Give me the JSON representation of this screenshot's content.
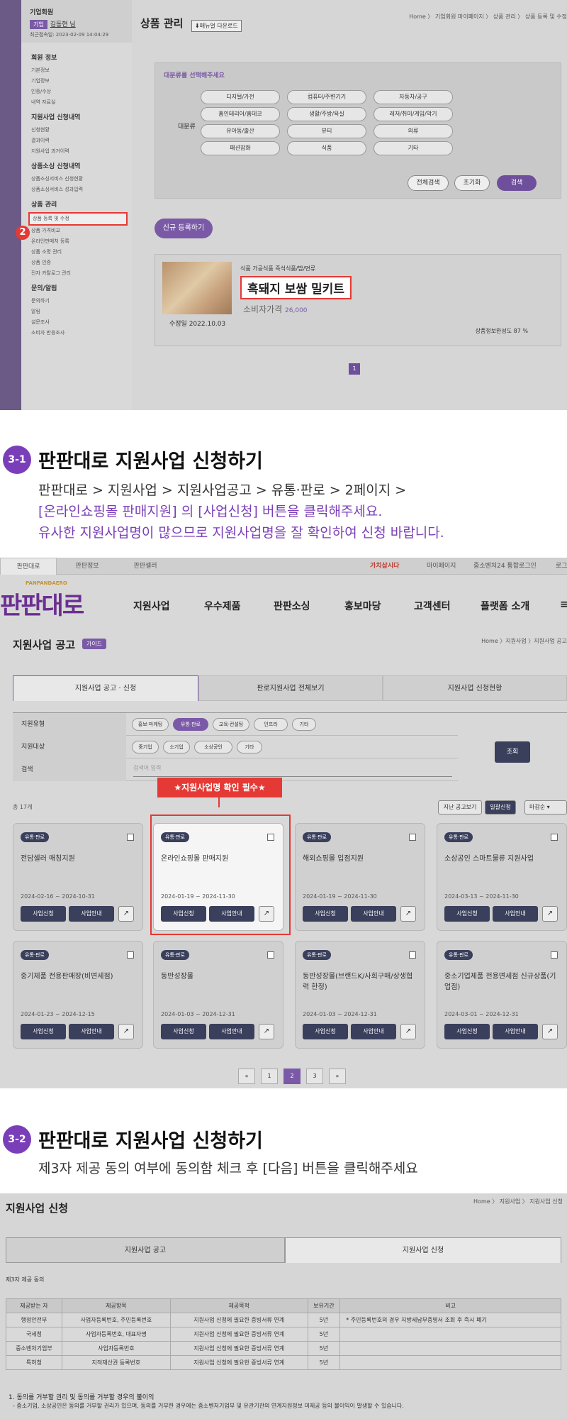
{
  "s1": {
    "user_type": "기업회원",
    "user_badge": "기업",
    "user_name": "김동현 님",
    "last_login": "최근접속일: 2023-02-09 14:04:29",
    "groups": [
      {
        "title": "회원 정보",
        "items": [
          "기본정보",
          "기업정보",
          "인증/수상",
          "내역 자료실"
        ]
      },
      {
        "title": "지원사업 신청내역",
        "items": [
          "신청현황",
          "결과이력",
          "지원사업 과거이력"
        ]
      },
      {
        "title": "상품소싱 신청내역",
        "items": [
          "상품소싱서비스 신청현황",
          "상품소싱서비스 성과입력"
        ]
      },
      {
        "title": "상품 관리",
        "items": [
          "상품 등록 및 수정",
          "상품 가격비교",
          "온라인판매처 등록",
          "상품 소명 관리",
          "상품 인증",
          "전자 카탈로그 관리"
        ]
      },
      {
        "title": "문의/알림",
        "items": [
          "문의하기",
          "알림",
          "설문조사",
          "소비자 반응조사"
        ]
      }
    ],
    "step_marker": "2",
    "page_title": "상품 관리",
    "manual_btn": "⬇매뉴얼 다운로드",
    "breadcrumb": "Home 〉 기업회원 마이페이지 〉 상품 관리 〉 상품 등록 및 수정",
    "filter_title": "대분류를 선택해주세요",
    "filter_label": "대분류",
    "categories": [
      "디지털/가전",
      "컴퓨터/주변기기",
      "자동차/공구",
      "홈인테리어/홈데코",
      "생활/주방/욕실",
      "레저/취미/게임/악기",
      "유아동/출산",
      "뷰티",
      "의류",
      "패션잡화",
      "식품",
      "기타"
    ],
    "btn_all": "전체검색",
    "btn_reset": "초기화",
    "btn_search": "검색",
    "btn_new": "신규 등록하기",
    "product": {
      "cats": "식품    가공식품    즉석식품/밥/면류",
      "name": "흑돼지 보쌈 밀키트",
      "price_label": "소비자가격",
      "price": "26,000",
      "edit_date": "수정일 2022.10.03",
      "completeness": "상품정보완성도 87 %"
    },
    "page": "1"
  },
  "step1": {
    "num": "3-1",
    "title": "판판대로 지원사업 신청하기",
    "line1": "판판대로 > 지원사업 > 지원사업공고 > 유통·판로 > 2페이지 >",
    "line2": "[온라인쇼핑몰 판매지원] 의 [사업신청] 버튼을 클릭해주세요.",
    "line3": "유사한 지원사업명이 많으므로 지원사업명을 잘 확인하여 신청 바랍니다."
  },
  "s2": {
    "top_tabs": [
      "판판대로",
      "판판정보",
      "판판셀러"
    ],
    "top_right": [
      "가치삽시다",
      "마이페이지",
      "중소벤처24 통합로그인",
      "로그"
    ],
    "logo": "판판대로",
    "logo_sub": "PANPANDAERO",
    "gnb": [
      "지원사업",
      "우수제품",
      "판판소싱",
      "홍보마당",
      "고객센터",
      "플랫폼 소개"
    ],
    "page_title": "지원사업 공고",
    "guide": "가이드",
    "breadcrumb": "Home 〉지원사업 〉지원사업 공고",
    "tabs": [
      "지원사업 공고 · 신청",
      "판로지원사업 전체보기",
      "지원사업 신청현황"
    ],
    "filter": {
      "type_label": "지원유형",
      "type_chips": [
        "홍보·마케팅",
        "유통·판로",
        "교육·컨설팅",
        "인프라",
        "기타"
      ],
      "target_label": "지원대상",
      "target_chips": [
        "중기업",
        "소기업",
        "소상공인",
        "기타"
      ],
      "search_label": "검색",
      "search_placeholder": "검색어 입력",
      "query_btn": "조회"
    },
    "notice": "★지원사업명 확인 필수★",
    "total": "총 17개",
    "btn_past": "지난 공고보기",
    "btn_bulk": "일괄신청",
    "sort": "마감순",
    "cards": [
      {
        "tag": "유통·판로",
        "name": "전담셀러 매칭지원",
        "period": "2024-02-16 ~ 2024-10-31"
      },
      {
        "tag": "유통·판로",
        "name": "온라인쇼핑몰 판매지원",
        "period": "2024-01-19 ~ 2024-11-30"
      },
      {
        "tag": "유통·판로",
        "name": "해외쇼핑몰 입점지원",
        "period": "2024-01-19 ~ 2024-11-30"
      },
      {
        "tag": "유통·판로",
        "name": "소상공인 스마트물류 지원사업",
        "period": "2024-03-13 ~ 2024-11-30"
      },
      {
        "tag": "유통·판로",
        "name": "중기제품 전용판매장(비면세점)",
        "period": "2024-01-23 ~ 2024-12-15"
      },
      {
        "tag": "유통·판로",
        "name": "동반성장몰",
        "period": "2024-01-03 ~ 2024-12-31"
      },
      {
        "tag": "유통·판로",
        "name": "동반성장몰(브랜드K/사회구매/상생협력 한정)",
        "period": "2024-01-03 ~ 2024-12-31"
      },
      {
        "tag": "유통·판로",
        "name": "중소기업제품 전용면세점 신규상품(기업점)",
        "period": "2024-03-01 ~ 2024-12-31"
      }
    ],
    "btn_apply": "사업신청",
    "btn_info": "사업안내",
    "link_icon": "↗",
    "pages": [
      "«",
      "1",
      "2",
      "3",
      "»"
    ]
  },
  "step2": {
    "num": "3-2",
    "title": "판판대로 지원사업 신청하기",
    "desc": "제3자 제공 동의 여부에 동의함 체크 후 [다음] 버튼을 클릭해주세요"
  },
  "s3": {
    "page_title": "지원사업 신청",
    "breadcrumb": "Home 〉 지원사업 〉 지원사업 신청",
    "tabs": [
      "지원사업 공고",
      "지원사업 신청"
    ],
    "section_label": "제3자 제공 동의",
    "headers": [
      "제공받는 자",
      "제공항목",
      "제공목적",
      "보유기간",
      "비고"
    ],
    "rows": [
      [
        "행정안전부",
        "사업자등록번호, 주민등록번호",
        "지원사업 신청에 필요한 증빙서류 연계",
        "5년",
        "* 주민등록번호의 경우 지방세납부증명서 조회 후 즉시 폐기"
      ],
      [
        "국세청",
        "사업자등록번호, 대표자명",
        "지원사업 신청에 필요한 증빙서류 연계",
        "5년",
        ""
      ],
      [
        "중소벤처기업부",
        "사업자등록번호",
        "지원사업 신청에 필요한 증빙서류 연계",
        "5년",
        ""
      ],
      [
        "특허청",
        "지적재산권 등록번호",
        "지원사업 신청에 필요한 증빙서류 연계",
        "5년",
        ""
      ]
    ],
    "note_title": "1. 동의를 거부할 권리 및 동의를 거부할 경우의 불이익",
    "note_body": "- 중소기업, 소상공인은 동의를 거부할 권리가 있으며, 동의를 거부한 경우에는 중소벤처기업부 및 유관기관의 연계지원정보 미제공 등의 불이익이 발생할 수 있습니다."
  }
}
